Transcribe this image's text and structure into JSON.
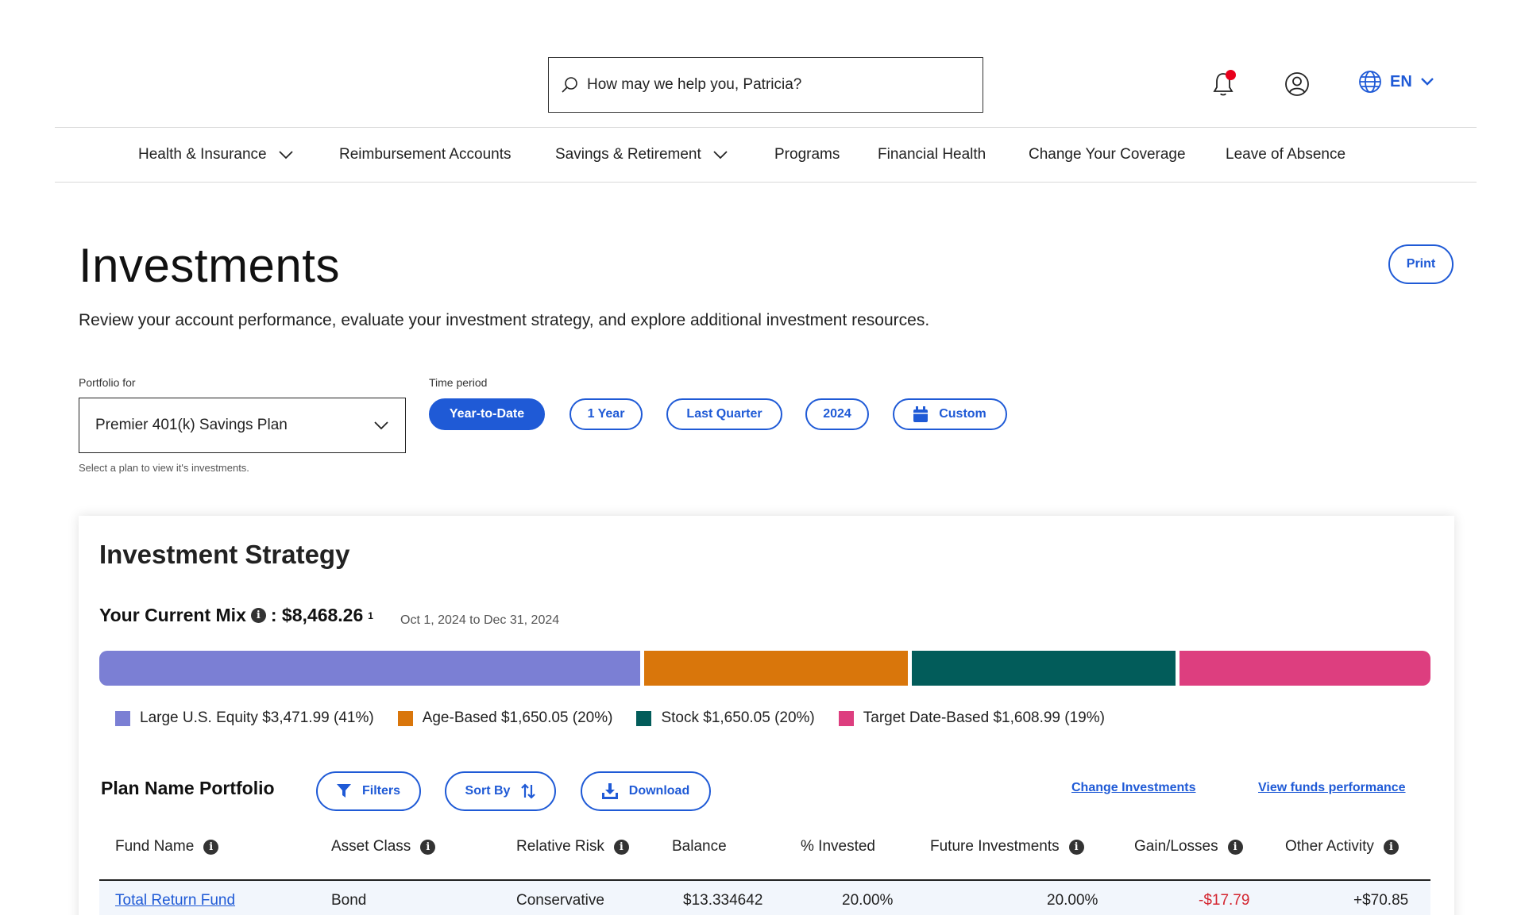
{
  "header": {
    "search_placeholder": "How may we help you, Patricia?",
    "language": "EN",
    "colors": {
      "accent": "#1f5ad6",
      "notification": "#e8001c"
    }
  },
  "nav": {
    "items": [
      {
        "label": "Health & Insurance",
        "has_dropdown": true
      },
      {
        "label": "Reimbursement Accounts",
        "has_dropdown": false
      },
      {
        "label": "Savings & Retirement",
        "has_dropdown": true
      },
      {
        "label": "Programs",
        "has_dropdown": false
      },
      {
        "label": "Financial Health",
        "has_dropdown": false
      },
      {
        "label": "Change Your Coverage",
        "has_dropdown": false
      },
      {
        "label": "Leave of Absence",
        "has_dropdown": false
      }
    ]
  },
  "page": {
    "title": "Investments",
    "print_label": "Print",
    "subtitle": "Review your account performance, evaluate your investment strategy, and explore additional investment resources."
  },
  "filters": {
    "portfolio_label": "Portfolio for",
    "portfolio_value": "Premier 401(k) Savings Plan",
    "portfolio_help": "Select a plan to view it's investments.",
    "time_label": "Time period",
    "time_options": [
      {
        "label": "Year-to-Date",
        "active": true
      },
      {
        "label": "1 Year",
        "active": false
      },
      {
        "label": "Last Quarter",
        "active": false
      },
      {
        "label": "2024",
        "active": false
      },
      {
        "label": "Custom",
        "active": false
      }
    ]
  },
  "strategy": {
    "title": "Investment Strategy",
    "mix_label": "Your Current Mix",
    "mix_total": ": $8,468.26",
    "mix_footnote": "1",
    "mix_dates": "Oct 1, 2024 to Dec 31, 2024",
    "mix": [
      {
        "name": "Large U.S. Equity",
        "label": "Large U.S. Equity $3,471.99 (41%)",
        "percent": 41,
        "color": "#7b7fd4"
      },
      {
        "name": "Age-Based",
        "label": "Age-Based $1,650.05 (20%)",
        "percent": 20,
        "color": "#d9760b"
      },
      {
        "name": "Stock",
        "label": "Stock $1,650.05 (20%)",
        "percent": 20,
        "color": "#025c5a"
      },
      {
        "name": "Target Date-Based",
        "label": "Target Date-Based $1,608.99 (19%)",
        "percent": 19,
        "color": "#dd3e7f"
      }
    ]
  },
  "portfolio": {
    "title": "Plan Name Portfolio",
    "filters_label": "Filters",
    "sort_label": "Sort By",
    "download_label": "Download",
    "change_link": "Change Investments",
    "performance_link": "View funds performance",
    "columns": [
      "Fund Name",
      "Asset Class",
      "Relative Risk",
      "Balance",
      "% Invested",
      "Future Investments",
      "Gain/Losses",
      "Other Activity"
    ],
    "rows": [
      {
        "fund": "Total Return Fund",
        "asset_class": "Bond",
        "risk": "Conservative",
        "balance": "$13.334642",
        "invested": "20.00%",
        "future": "20.00%",
        "gain": "-$17.79",
        "other": "+$70.85"
      }
    ]
  }
}
